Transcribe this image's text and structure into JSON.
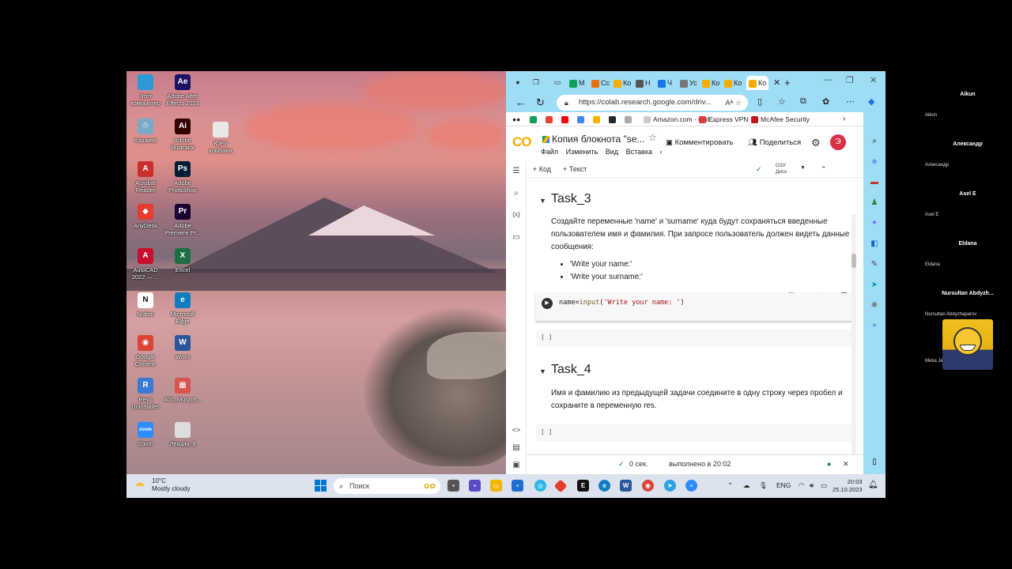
{
  "desktop": {
    "icons": [
      {
        "label": "Этот компьютер",
        "color": "#2d9ad8",
        "glyph": ""
      },
      {
        "label": "Adobe After Effects 2023",
        "color": "#1b1464",
        "glyph": "Ae"
      },
      {
        "label": "Корзина",
        "color": "#7aa9c8",
        "glyph": "♲"
      },
      {
        "label": "Adobe Illustrator",
        "color": "#330000",
        "glyph": "Ai"
      },
      {
        "label": "ЮРУ комбайн",
        "color": "#e8e8e8",
        "glyph": ""
      },
      {
        "label": "Acrobat Reader",
        "color": "#c9302c",
        "glyph": "A"
      },
      {
        "label": "Adobe Photoshop",
        "color": "#001e36",
        "glyph": "Ps"
      },
      {
        "label": "AnyDesk",
        "color": "#e63b2e",
        "glyph": "◆"
      },
      {
        "label": "Adobe Premiere Pr...",
        "color": "#1a0033",
        "glyph": "Pr"
      },
      {
        "label": "AutoCAD 2022 — ...",
        "color": "#c8102e",
        "glyph": "A"
      },
      {
        "label": "Excel",
        "color": "#1d6f42",
        "glyph": "X"
      },
      {
        "label": "Notion",
        "color": "#ffffff",
        "glyph": "N"
      },
      {
        "label": "Microsoft Edge",
        "color": "#0f7dc2",
        "glyph": "e"
      },
      {
        "label": "Google Chrome",
        "color": "#db4437",
        "glyph": "◉"
      },
      {
        "label": "Word",
        "color": "#2b579a",
        "glyph": "W"
      },
      {
        "label": "Revo Uninstaller",
        "color": "#3a7bd5",
        "glyph": "R"
      },
      {
        "label": "400_Must_h...",
        "color": "#d9534f",
        "glyph": "▦"
      },
      {
        "label": "Zoom",
        "color": "#2d8cff",
        "glyph": "zoom"
      },
      {
        "label": "Лекция_6",
        "color": "#dddddd",
        "glyph": ""
      }
    ]
  },
  "browser": {
    "tabs": [
      "М",
      "Сс",
      "Ко",
      "Н",
      "Ч",
      "Ус",
      "Ко",
      "Ко",
      "Ко"
    ],
    "active_tab": "Ко",
    "new_tab": "+",
    "url": "https://colab.research.google.com/driv...",
    "read_aloud": "Aᴬ",
    "bookmarks": [
      {
        "label": "Amazon.com - Onli...",
        "color": "#333"
      },
      {
        "label": "Express VPN",
        "color": "#da3940"
      },
      {
        "label": "McAfee Security",
        "color": "#c01818"
      }
    ]
  },
  "colab": {
    "logo": "CO",
    "title": "Копия блокнота \"se...",
    "menus": [
      "Файл",
      "Изменить",
      "Вид",
      "Вставка"
    ],
    "comment_label": "Комментировать",
    "share_label": "Поделиться",
    "avatar_letter": "Э",
    "toolbar": {
      "add_code": "+ Код",
      "add_text": "+ Текст",
      "ram": "ОЗУ",
      "disk": "Диск"
    },
    "cells": {
      "task3_title": "Task_3",
      "task3_text": "Создайте переменные 'name' и 'surname' куда будут сохраняться введенные пользователем имя и фамилия. При запросе пользователь должен видеть данные сообщения:",
      "task3_bullets": [
        "'Write your name:'",
        "'Write your surname:'"
      ],
      "code_var": "name=",
      "code_fn": "input",
      "code_open": "(",
      "code_str": "'Write your name: '",
      "code_close": ")",
      "empty_bracket": "[ ]",
      "task4_title": "Task_4",
      "task4_text": "Имя и фамилию из предыдущей задачи соедините в одну строку через пробел и сохраните в переменную res."
    },
    "status": {
      "time": "0 сек.",
      "done": "выполнено в 20:02"
    }
  },
  "taskbar": {
    "temperature": "10°C",
    "weather": "Mostly cloudy",
    "search_placeholder": "Поиск",
    "lang": "ENG",
    "time": "20:03",
    "date": "25.10.2023"
  },
  "participants": [
    {
      "name": "Aikun",
      "sub": "Aikun"
    },
    {
      "name": "Александр",
      "sub": "Александр"
    },
    {
      "name": "Asel E",
      "sub": "Asel E"
    },
    {
      "name": "Eldana",
      "sub": "Eldana"
    },
    {
      "name": "Nursultan Abdyzh...",
      "sub": "Nursultan Abdyzhaparov"
    },
    {
      "name": "",
      "sub": "Meka Jeen"
    }
  ]
}
